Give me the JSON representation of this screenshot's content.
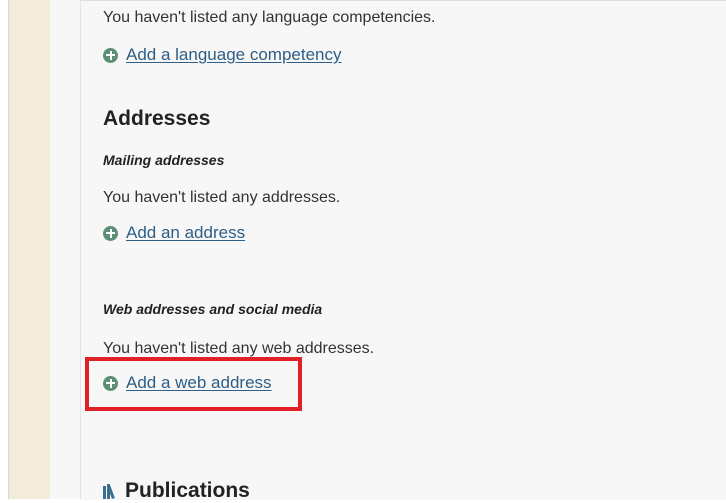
{
  "languages": {
    "empty_text": "You haven't listed any language competencies.",
    "add_link": "Add a language competency"
  },
  "addresses": {
    "heading": "Addresses",
    "mailing": {
      "heading": "Mailing addresses",
      "empty_text": "You haven't listed any addresses.",
      "add_link": "Add an address"
    },
    "web": {
      "heading": "Web addresses and social media",
      "empty_text": "You haven't listed any web addresses.",
      "add_link": "Add a web address"
    }
  },
  "publications": {
    "heading": "Publications",
    "icon": "books-icon"
  },
  "colors": {
    "link": "#2e5d86",
    "plus_icon": "#5f8e77",
    "highlight": "#e0212a",
    "sidebar": "#f3ecdc"
  }
}
